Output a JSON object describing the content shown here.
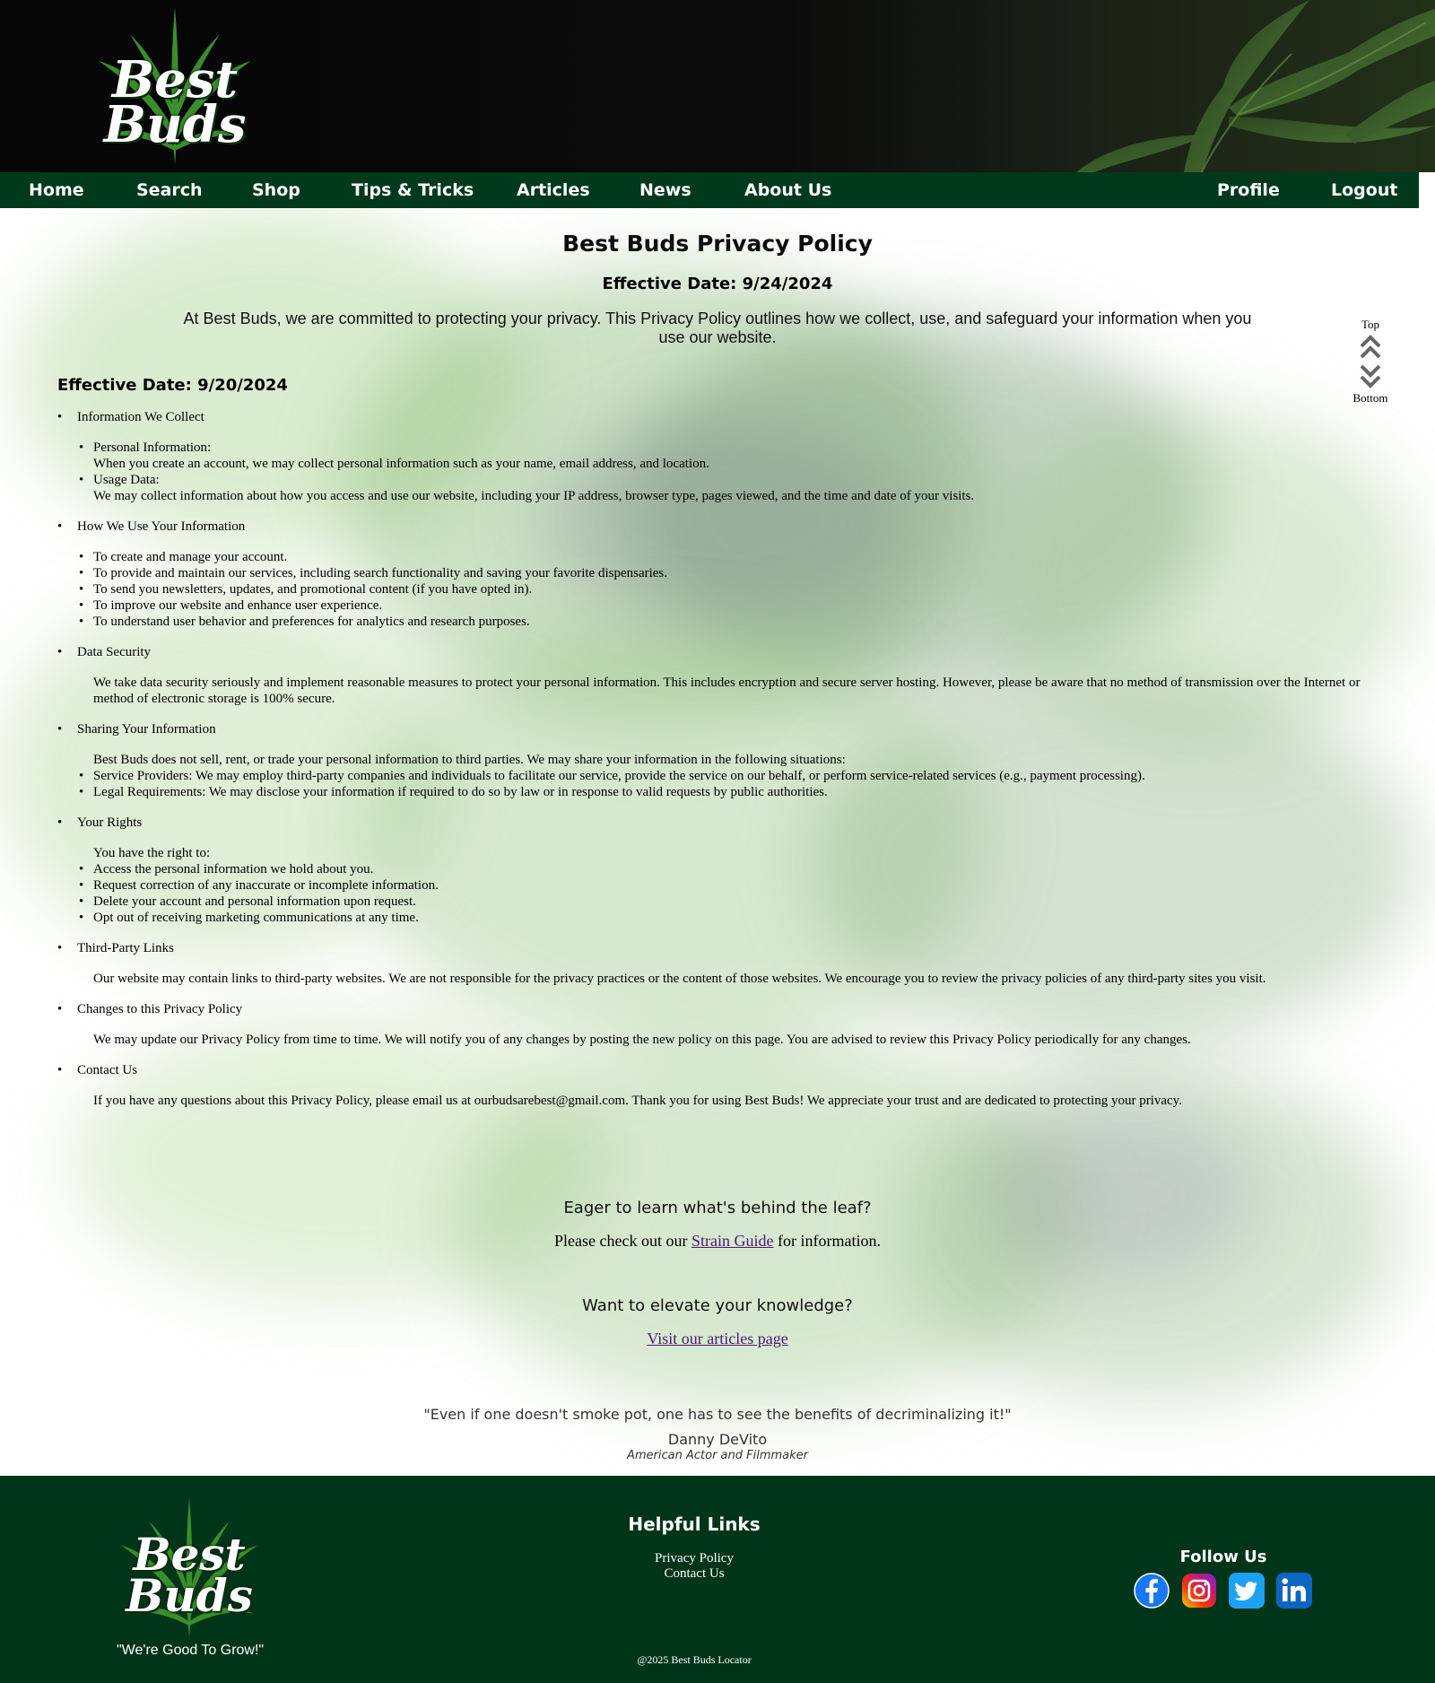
{
  "header": {
    "logo_text_line1": "Best",
    "logo_text_line2": "Buds"
  },
  "nav": {
    "left": [
      "Home",
      "Search",
      "Shop",
      "Tips & Tricks",
      "Articles",
      "News",
      "About Us"
    ],
    "right": [
      "Profile",
      "Logout"
    ]
  },
  "page": {
    "title": "Best Buds Privacy Policy",
    "effective_top": "Effective Date: 9/24/2024",
    "intro": "At Best Buds, we are committed to protecting your privacy. This Privacy Policy outlines how we collect, use, and safeguard your information when you use our website.",
    "effective_second": "Effective Date: 9/20/2024"
  },
  "policy": {
    "collect": {
      "title": "Information We Collect",
      "items": [
        {
          "label": "Personal Information:",
          "desc": "When you create an account, we may collect personal information such as your name, email address, and location."
        },
        {
          "label": "Usage Data:",
          "desc": "We may collect information about how you access and use our website, including your IP address, browser type, pages viewed, and the time and date of your visits."
        }
      ]
    },
    "use": {
      "title": "How We Use Your Information",
      "items": [
        "To create and manage your account.",
        "To provide and maintain our services, including search functionality and saving your favorite dispensaries.",
        "To send you newsletters, updates, and promotional content (if you have opted in).",
        "To improve our website and enhance user experience.",
        "To understand user behavior and preferences for analytics and research purposes."
      ]
    },
    "security": {
      "title": "Data Security",
      "text": "We take data security seriously and implement reasonable measures to protect your personal information. This includes encryption and secure server hosting. However, please be aware that no method of transmission over the Internet or method of electronic storage is 100% secure."
    },
    "sharing": {
      "title": "Sharing Your Information",
      "lead": "Best Buds does not sell, rent, or trade your personal information to third parties. We may share your information in the following situations:",
      "items": [
        "Service Providers: We may employ third-party companies and individuals to facilitate our service, provide the service on our behalf, or perform service-related services (e.g., payment processing).",
        "Legal Requirements: We may disclose your information if required to do so by law or in response to valid requests by public authorities."
      ]
    },
    "rights": {
      "title": "Your Rights",
      "lead": "You have the right to:",
      "items": [
        "Access the personal information we hold about you.",
        "Request correction of any inaccurate or incomplete information.",
        "Delete your account and personal information upon request.",
        "Opt out of receiving marketing communications at any time."
      ]
    },
    "third_party": {
      "title": "Third-Party Links",
      "text": "Our website may contain links to third-party websites. We are not responsible for the privacy practices or the content of those websites. We encourage you to review the privacy policies of any third-party sites you visit."
    },
    "changes": {
      "title": "Changes to this Privacy Policy",
      "text": "We may update our Privacy Policy from time to time. We will notify you of any changes by posting the new policy on this page. You are advised to review this Privacy Policy periodically for any changes."
    },
    "contact": {
      "title": "Contact Us",
      "text": "If you have any questions about this Privacy Policy, please email us at ourbudsarebest@gmail.com. Thank you for using Best Buds! We appreciate your trust and are dedicated to protecting your privacy."
    }
  },
  "scroll_widget": {
    "top": "Top",
    "bottom": "Bottom"
  },
  "cta": {
    "heading1": "Eager to learn what's behind the leaf?",
    "text1_before": "Please check out our",
    "text1_link": "Strain Guide",
    "text1_after": "for information.",
    "heading2": "Want to elevate your knowledge?",
    "link2": "Visit our articles page"
  },
  "quote": {
    "text": "\"Even if one doesn't smoke pot, one has to see the benefits of decriminalizing it!\"",
    "author": "Danny DeVito",
    "role": "American Actor and Filmmaker"
  },
  "footer": {
    "tagline": "\"We're Good To Grow!\"",
    "helpful_title": "Helpful Links",
    "links": [
      "Privacy Policy",
      "Contact Us"
    ],
    "follow_title": "Follow Us",
    "social": [
      "facebook-icon",
      "instagram-icon",
      "twitter-icon",
      "linkedin-icon"
    ],
    "copyright": "@2025 Best Buds Locator"
  },
  "colors": {
    "nav_bg": "#01391c",
    "footer_bg": "#01351a",
    "link": "#4d1a73"
  }
}
